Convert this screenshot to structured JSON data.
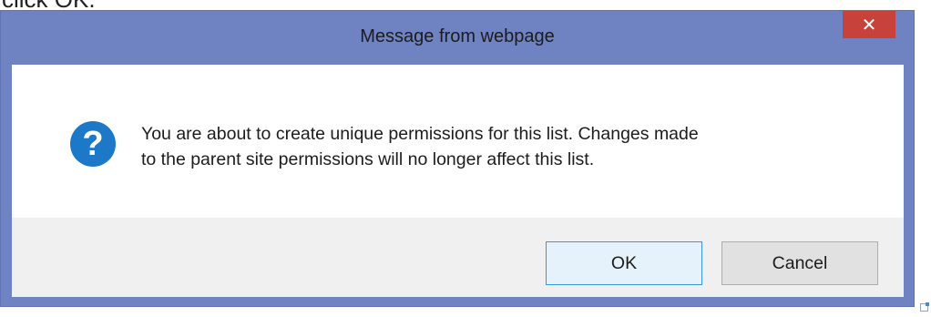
{
  "page": {
    "cropped_text": "click OK."
  },
  "dialog": {
    "title": "Message from webpage",
    "close_label": "✕",
    "icon": "question-icon",
    "icon_glyph": "?",
    "message_lines": [
      "You are about to create unique permissions for this list. Changes made",
      "to the parent site permissions will no longer affect this list."
    ],
    "buttons": {
      "ok": "OK",
      "cancel": "Cancel"
    }
  },
  "colors": {
    "frame": "#6f82c2",
    "close": "#c7423a",
    "icon": "#1e78c8",
    "button_focus_border": "#3c96dc"
  }
}
